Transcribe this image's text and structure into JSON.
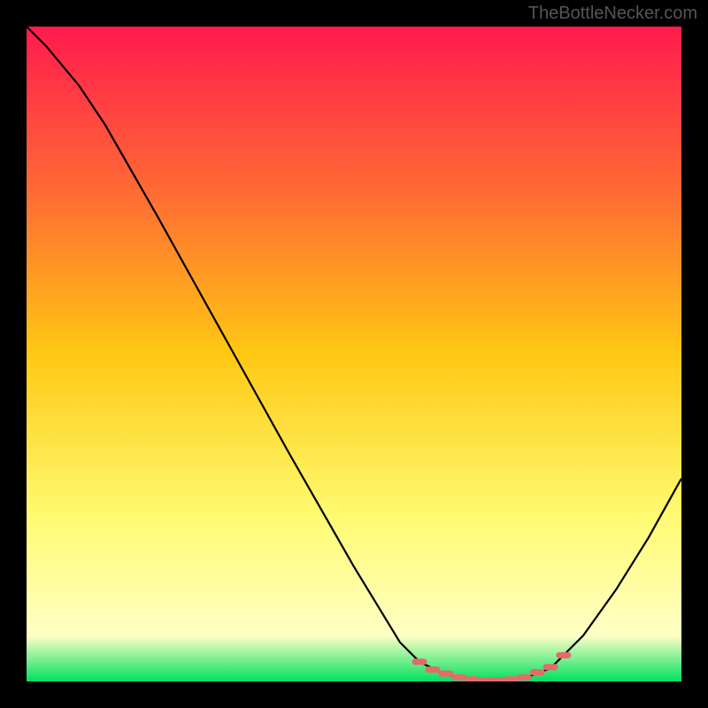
{
  "watermark": "TheBottleNecker.com",
  "chart_data": {
    "type": "line",
    "title": "",
    "xlabel": "",
    "ylabel": "",
    "xlim": [
      0,
      100
    ],
    "ylim": [
      0,
      100
    ],
    "gradient_stops": [
      {
        "offset": 0,
        "color": "#ff1a4d"
      },
      {
        "offset": 25,
        "color": "#ff6a35"
      },
      {
        "offset": 50,
        "color": "#ffc813"
      },
      {
        "offset": 75,
        "color": "#fffb73"
      },
      {
        "offset": 93,
        "color": "#ffffc5"
      },
      {
        "offset": 100,
        "color": "#00e060"
      }
    ],
    "series": [
      {
        "name": "curve",
        "color": "#000000",
        "points": [
          {
            "x": 0,
            "y": 100
          },
          {
            "x": 3,
            "y": 97
          },
          {
            "x": 8,
            "y": 91
          },
          {
            "x": 12,
            "y": 85
          },
          {
            "x": 20,
            "y": 71
          },
          {
            "x": 30,
            "y": 53
          },
          {
            "x": 40,
            "y": 35
          },
          {
            "x": 50,
            "y": 17.5
          },
          {
            "x": 57,
            "y": 6
          },
          {
            "x": 60,
            "y": 3
          },
          {
            "x": 64,
            "y": 1
          },
          {
            "x": 70,
            "y": 0
          },
          {
            "x": 76,
            "y": 0.5
          },
          {
            "x": 80,
            "y": 2
          },
          {
            "x": 85,
            "y": 7
          },
          {
            "x": 90,
            "y": 14
          },
          {
            "x": 95,
            "y": 22
          },
          {
            "x": 100,
            "y": 31
          }
        ]
      },
      {
        "name": "markers",
        "color": "#e56a6a",
        "points": [
          {
            "x": 60,
            "y": 3
          },
          {
            "x": 62,
            "y": 1.8
          },
          {
            "x": 64,
            "y": 1.2
          },
          {
            "x": 66,
            "y": 0.6
          },
          {
            "x": 68,
            "y": 0.3
          },
          {
            "x": 70,
            "y": 0.1
          },
          {
            "x": 72,
            "y": 0.2
          },
          {
            "x": 74,
            "y": 0.3
          },
          {
            "x": 76,
            "y": 0.6
          },
          {
            "x": 78,
            "y": 1.4
          },
          {
            "x": 80,
            "y": 2.2
          },
          {
            "x": 82,
            "y": 4
          }
        ]
      }
    ]
  }
}
